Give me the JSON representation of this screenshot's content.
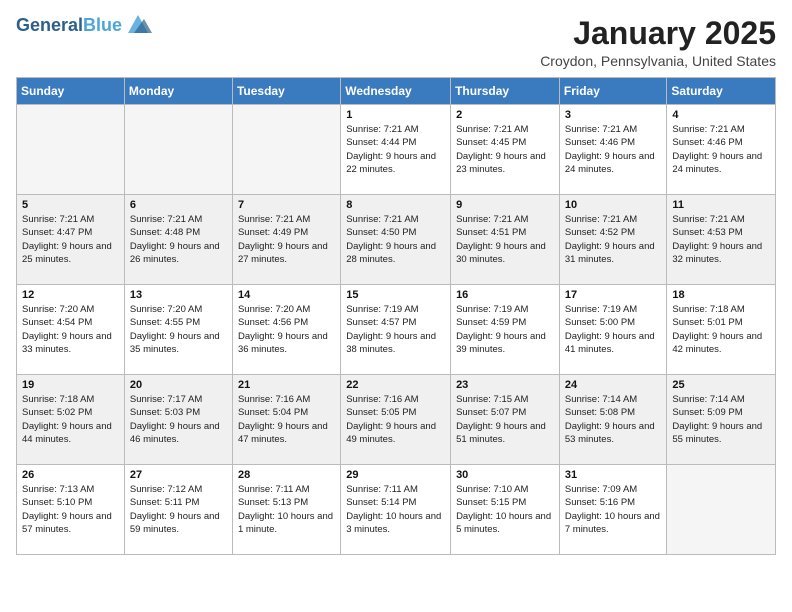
{
  "header": {
    "logo_line1": "General",
    "logo_line2": "Blue",
    "month": "January 2025",
    "location": "Croydon, Pennsylvania, United States"
  },
  "weekdays": [
    "Sunday",
    "Monday",
    "Tuesday",
    "Wednesday",
    "Thursday",
    "Friday",
    "Saturday"
  ],
  "weeks": [
    [
      {
        "day": "",
        "sunrise": "",
        "sunset": "",
        "daylight": "",
        "empty": true
      },
      {
        "day": "",
        "sunrise": "",
        "sunset": "",
        "daylight": "",
        "empty": true
      },
      {
        "day": "",
        "sunrise": "",
        "sunset": "",
        "daylight": "",
        "empty": true
      },
      {
        "day": "1",
        "sunrise": "Sunrise: 7:21 AM",
        "sunset": "Sunset: 4:44 PM",
        "daylight": "Daylight: 9 hours and 22 minutes."
      },
      {
        "day": "2",
        "sunrise": "Sunrise: 7:21 AM",
        "sunset": "Sunset: 4:45 PM",
        "daylight": "Daylight: 9 hours and 23 minutes."
      },
      {
        "day": "3",
        "sunrise": "Sunrise: 7:21 AM",
        "sunset": "Sunset: 4:46 PM",
        "daylight": "Daylight: 9 hours and 24 minutes."
      },
      {
        "day": "4",
        "sunrise": "Sunrise: 7:21 AM",
        "sunset": "Sunset: 4:46 PM",
        "daylight": "Daylight: 9 hours and 24 minutes."
      }
    ],
    [
      {
        "day": "5",
        "sunrise": "Sunrise: 7:21 AM",
        "sunset": "Sunset: 4:47 PM",
        "daylight": "Daylight: 9 hours and 25 minutes."
      },
      {
        "day": "6",
        "sunrise": "Sunrise: 7:21 AM",
        "sunset": "Sunset: 4:48 PM",
        "daylight": "Daylight: 9 hours and 26 minutes."
      },
      {
        "day": "7",
        "sunrise": "Sunrise: 7:21 AM",
        "sunset": "Sunset: 4:49 PM",
        "daylight": "Daylight: 9 hours and 27 minutes."
      },
      {
        "day": "8",
        "sunrise": "Sunrise: 7:21 AM",
        "sunset": "Sunset: 4:50 PM",
        "daylight": "Daylight: 9 hours and 28 minutes."
      },
      {
        "day": "9",
        "sunrise": "Sunrise: 7:21 AM",
        "sunset": "Sunset: 4:51 PM",
        "daylight": "Daylight: 9 hours and 30 minutes."
      },
      {
        "day": "10",
        "sunrise": "Sunrise: 7:21 AM",
        "sunset": "Sunset: 4:52 PM",
        "daylight": "Daylight: 9 hours and 31 minutes."
      },
      {
        "day": "11",
        "sunrise": "Sunrise: 7:21 AM",
        "sunset": "Sunset: 4:53 PM",
        "daylight": "Daylight: 9 hours and 32 minutes."
      }
    ],
    [
      {
        "day": "12",
        "sunrise": "Sunrise: 7:20 AM",
        "sunset": "Sunset: 4:54 PM",
        "daylight": "Daylight: 9 hours and 33 minutes."
      },
      {
        "day": "13",
        "sunrise": "Sunrise: 7:20 AM",
        "sunset": "Sunset: 4:55 PM",
        "daylight": "Daylight: 9 hours and 35 minutes."
      },
      {
        "day": "14",
        "sunrise": "Sunrise: 7:20 AM",
        "sunset": "Sunset: 4:56 PM",
        "daylight": "Daylight: 9 hours and 36 minutes."
      },
      {
        "day": "15",
        "sunrise": "Sunrise: 7:19 AM",
        "sunset": "Sunset: 4:57 PM",
        "daylight": "Daylight: 9 hours and 38 minutes."
      },
      {
        "day": "16",
        "sunrise": "Sunrise: 7:19 AM",
        "sunset": "Sunset: 4:59 PM",
        "daylight": "Daylight: 9 hours and 39 minutes."
      },
      {
        "day": "17",
        "sunrise": "Sunrise: 7:19 AM",
        "sunset": "Sunset: 5:00 PM",
        "daylight": "Daylight: 9 hours and 41 minutes."
      },
      {
        "day": "18",
        "sunrise": "Sunrise: 7:18 AM",
        "sunset": "Sunset: 5:01 PM",
        "daylight": "Daylight: 9 hours and 42 minutes."
      }
    ],
    [
      {
        "day": "19",
        "sunrise": "Sunrise: 7:18 AM",
        "sunset": "Sunset: 5:02 PM",
        "daylight": "Daylight: 9 hours and 44 minutes."
      },
      {
        "day": "20",
        "sunrise": "Sunrise: 7:17 AM",
        "sunset": "Sunset: 5:03 PM",
        "daylight": "Daylight: 9 hours and 46 minutes."
      },
      {
        "day": "21",
        "sunrise": "Sunrise: 7:16 AM",
        "sunset": "Sunset: 5:04 PM",
        "daylight": "Daylight: 9 hours and 47 minutes."
      },
      {
        "day": "22",
        "sunrise": "Sunrise: 7:16 AM",
        "sunset": "Sunset: 5:05 PM",
        "daylight": "Daylight: 9 hours and 49 minutes."
      },
      {
        "day": "23",
        "sunrise": "Sunrise: 7:15 AM",
        "sunset": "Sunset: 5:07 PM",
        "daylight": "Daylight: 9 hours and 51 minutes."
      },
      {
        "day": "24",
        "sunrise": "Sunrise: 7:14 AM",
        "sunset": "Sunset: 5:08 PM",
        "daylight": "Daylight: 9 hours and 53 minutes."
      },
      {
        "day": "25",
        "sunrise": "Sunrise: 7:14 AM",
        "sunset": "Sunset: 5:09 PM",
        "daylight": "Daylight: 9 hours and 55 minutes."
      }
    ],
    [
      {
        "day": "26",
        "sunrise": "Sunrise: 7:13 AM",
        "sunset": "Sunset: 5:10 PM",
        "daylight": "Daylight: 9 hours and 57 minutes."
      },
      {
        "day": "27",
        "sunrise": "Sunrise: 7:12 AM",
        "sunset": "Sunset: 5:11 PM",
        "daylight": "Daylight: 9 hours and 59 minutes."
      },
      {
        "day": "28",
        "sunrise": "Sunrise: 7:11 AM",
        "sunset": "Sunset: 5:13 PM",
        "daylight": "Daylight: 10 hours and 1 minute."
      },
      {
        "day": "29",
        "sunrise": "Sunrise: 7:11 AM",
        "sunset": "Sunset: 5:14 PM",
        "daylight": "Daylight: 10 hours and 3 minutes."
      },
      {
        "day": "30",
        "sunrise": "Sunrise: 7:10 AM",
        "sunset": "Sunset: 5:15 PM",
        "daylight": "Daylight: 10 hours and 5 minutes."
      },
      {
        "day": "31",
        "sunrise": "Sunrise: 7:09 AM",
        "sunset": "Sunset: 5:16 PM",
        "daylight": "Daylight: 10 hours and 7 minutes."
      },
      {
        "day": "",
        "sunrise": "",
        "sunset": "",
        "daylight": "",
        "empty": true
      }
    ]
  ]
}
